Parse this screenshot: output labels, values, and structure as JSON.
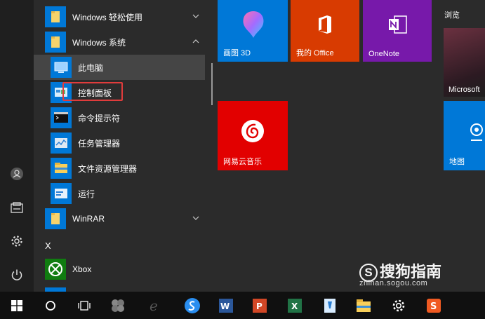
{
  "rail": {
    "icons": [
      "user-icon",
      "documents-icon",
      "settings-icon",
      "power-icon"
    ]
  },
  "applist": {
    "items": [
      {
        "label": "Windows 轻松使用",
        "icon": "folder-icon",
        "expand": "chevron-down-icon"
      },
      {
        "label": "Windows 系统",
        "icon": "folder-icon",
        "expand": "chevron-up-icon"
      },
      {
        "label": "此电脑",
        "icon": "this-pc-icon"
      },
      {
        "label": "控制面板",
        "icon": "control-panel-icon"
      },
      {
        "label": "命令提示符",
        "icon": "command-prompt-icon"
      },
      {
        "label": "任务管理器",
        "icon": "task-manager-icon"
      },
      {
        "label": "文件资源管理器",
        "icon": "file-explorer-icon"
      },
      {
        "label": "运行",
        "icon": "run-icon"
      },
      {
        "label": "WinRAR",
        "icon": "folder-icon",
        "expand": "chevron-down-icon"
      },
      {
        "label": "Xbox",
        "icon": "xbox-icon"
      }
    ],
    "section_letter": "X"
  },
  "tiles": {
    "paint3d": {
      "label": "画图 3D",
      "color": "#0078d7"
    },
    "office": {
      "label": "我的 Office",
      "color": "#d83b01"
    },
    "onenote": {
      "label": "OneNote",
      "color": "#7719aa"
    },
    "netease": {
      "label": "网易云音乐",
      "color": "#e20000"
    },
    "browse_title": "浏览",
    "microsoft": {
      "label": "Microsoft"
    },
    "maps": {
      "label": "地图",
      "color": "#0078d7"
    }
  },
  "taskbar": {
    "icons": [
      "windows-start-icon",
      "cortana-search-icon",
      "task-view-icon",
      "app-icon",
      "ie-icon",
      "sogou-browser-icon",
      "word-icon",
      "powerpoint-icon",
      "excel-icon",
      "paint-icon",
      "file-explorer-icon",
      "settings-icon",
      "sogou-input-icon"
    ]
  },
  "watermark": {
    "logo": "搜狗指南",
    "url": "zhinan.sogou.com"
  },
  "colors": {
    "accent": "#0078d7",
    "highlight_box": "#e03c3c"
  }
}
